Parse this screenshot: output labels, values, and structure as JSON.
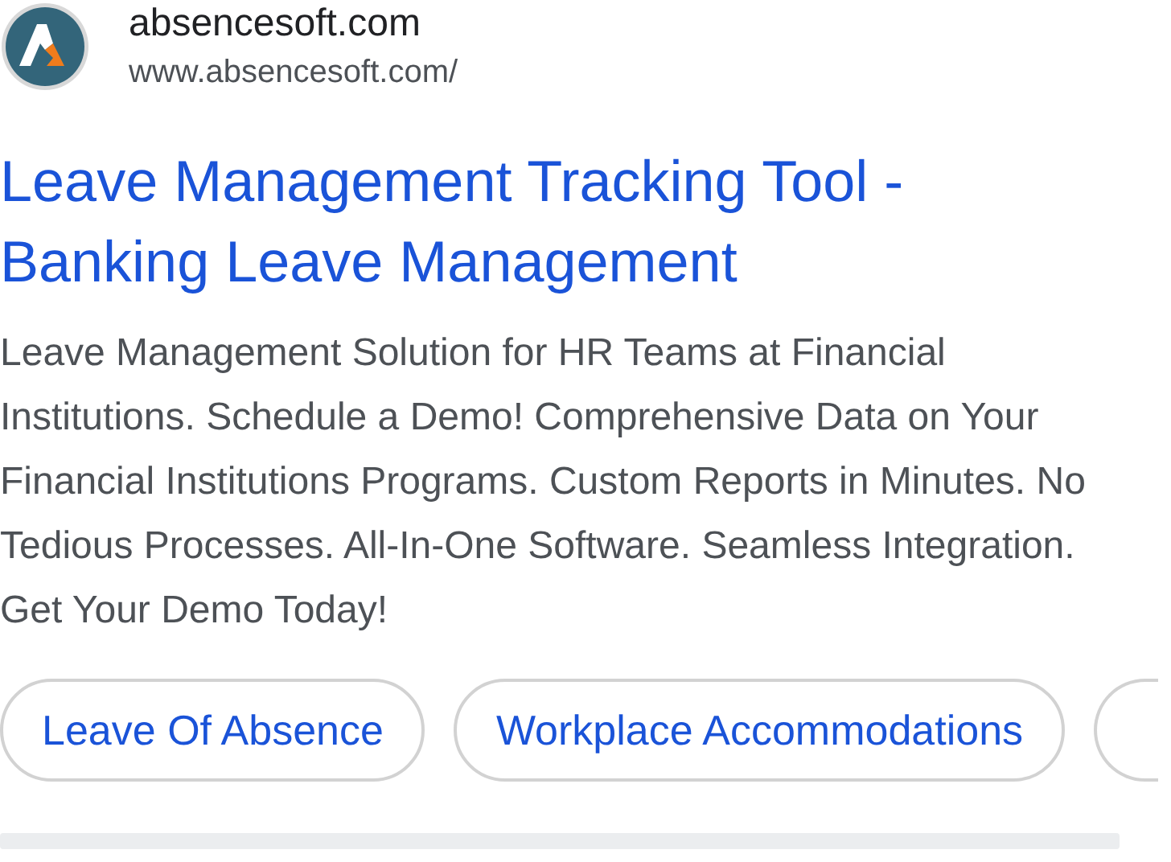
{
  "result": {
    "site_name": "absencesoft.com",
    "url": "www.absencesoft.com/",
    "title": "Leave Management Tracking Tool - Banking Leave Management",
    "description": "Leave Management Solution for HR Teams at Financial Institutions. Schedule a Demo! Comprehensive Data on Your Financial Institutions Programs. Custom Reports in Minutes. No Tedious Processes. All-In-One Software. Seamless Integration. Get Your Demo Today!",
    "sitelinks": [
      {
        "label": "Leave Of Absence"
      },
      {
        "label": "Workplace Accommodations"
      }
    ]
  }
}
